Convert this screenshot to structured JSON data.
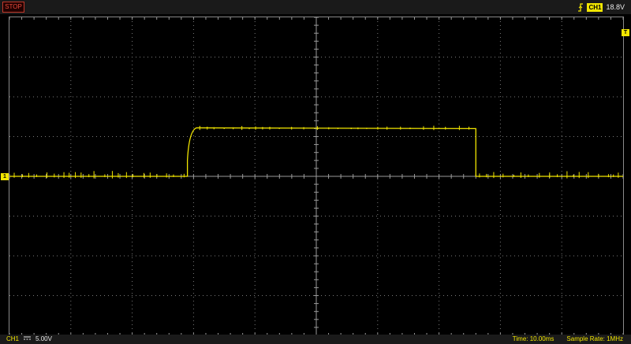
{
  "status": {
    "run_state": "STOP"
  },
  "trigger": {
    "channel": "CH1",
    "level": "18.8V",
    "icon": "trigger-edge-icon"
  },
  "channel": {
    "name": "CH1",
    "coupling_icon": "dc-coupling-icon",
    "volts_per_div": "5.00V",
    "marker_label": "1"
  },
  "timebase": {
    "text": "Time: 10.00ms"
  },
  "sample": {
    "text": "Sample Rate: 1MHz"
  },
  "trigger_marker": {
    "label": "T"
  },
  "colors": {
    "trace": "#f2e600",
    "grid": "#7a7a7a",
    "stop": "#e74c3c"
  },
  "waveform": {
    "divisions": {
      "x": 10,
      "y": 8
    },
    "baseline_div": 0,
    "pulse_high_div": 1.2,
    "pulse_start_div": -2.1,
    "pulse_end_div": 2.6,
    "rise_time_div": 0.15
  }
}
